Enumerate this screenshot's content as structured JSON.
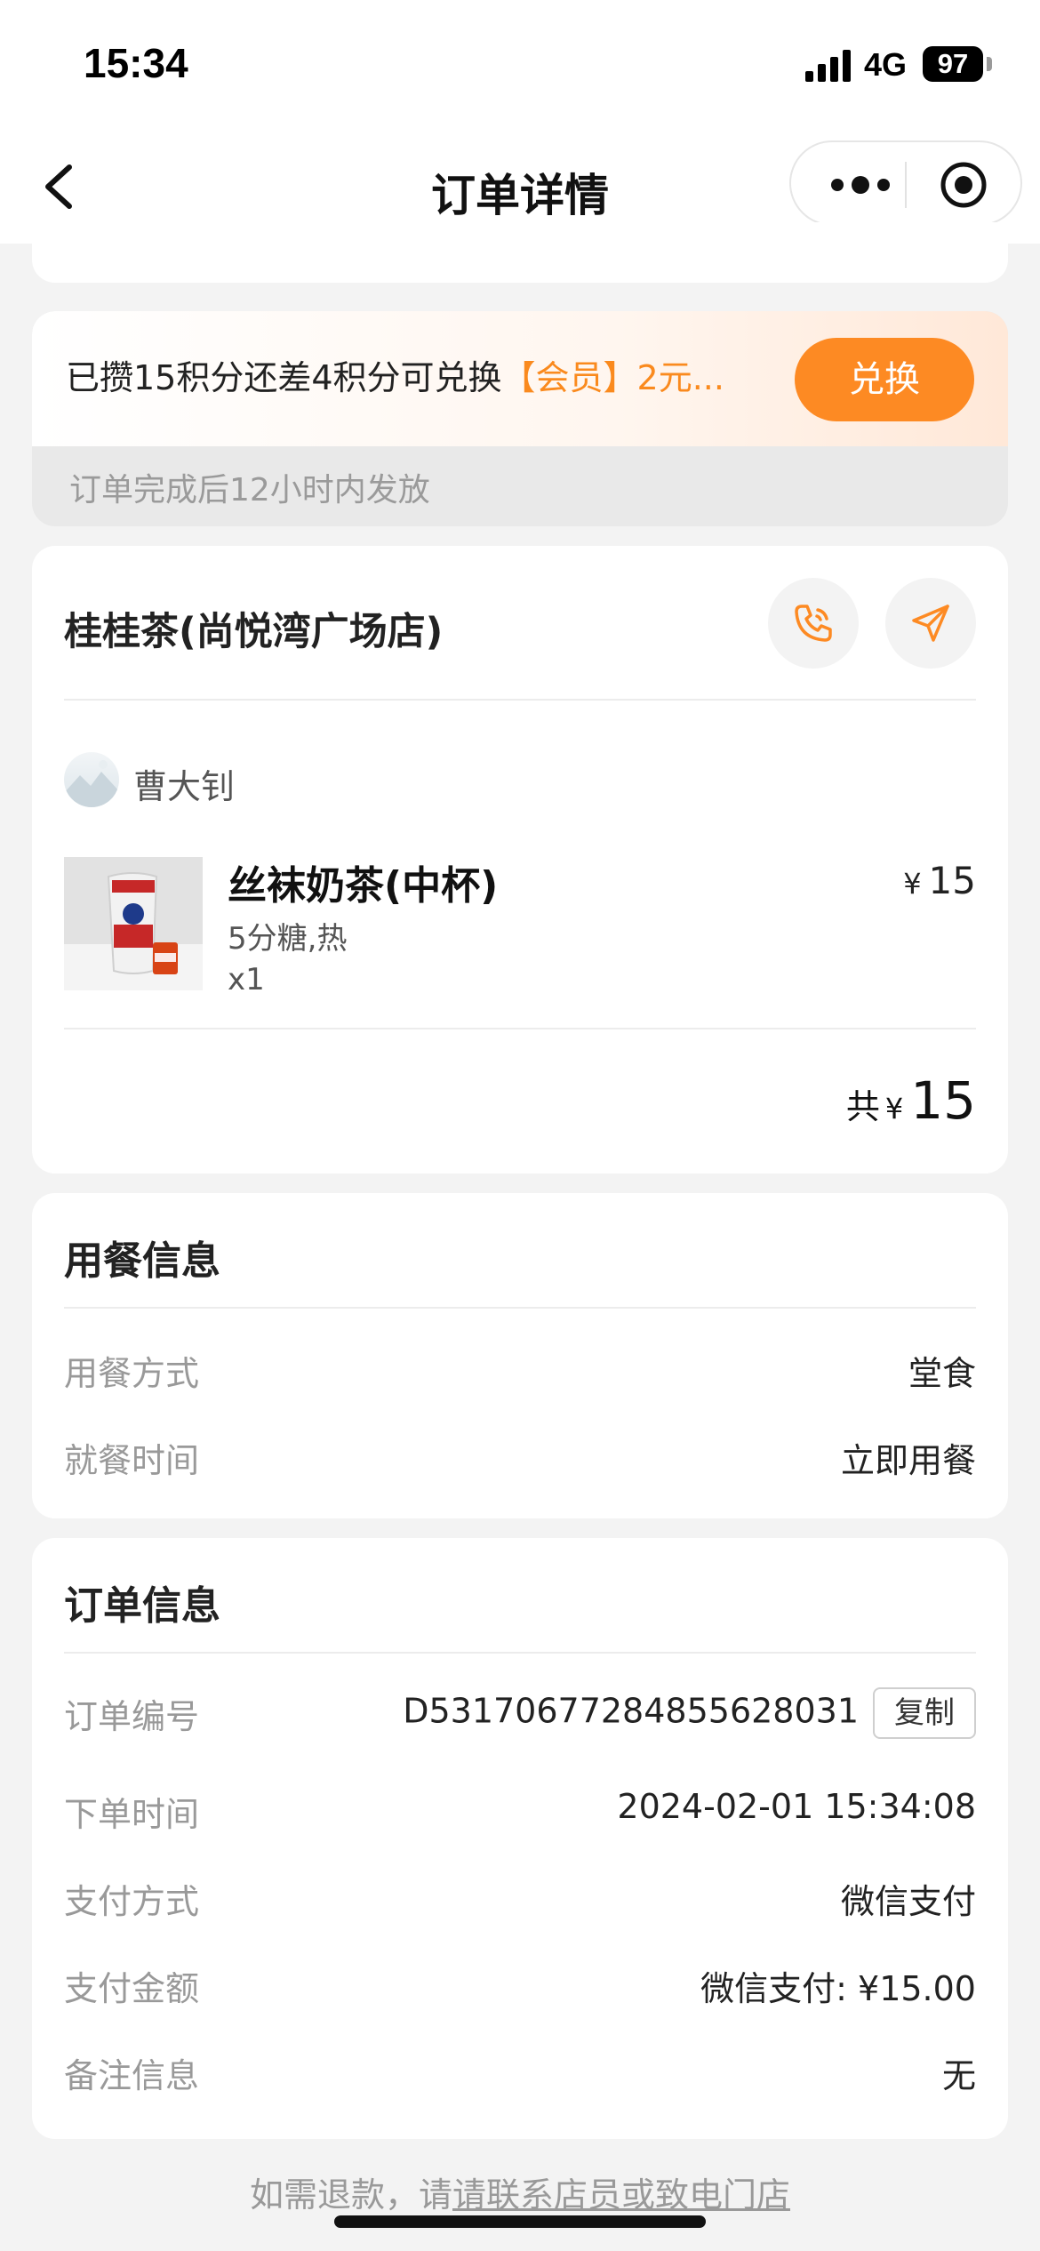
{
  "status_bar": {
    "time": "15:34",
    "network": "4G",
    "battery": "97"
  },
  "nav": {
    "title": "订单详情"
  },
  "points": {
    "text_prefix": "已攒15积分还差4积分可兑换",
    "text_highlight": "【会员】2元...",
    "redeem_label": "兑换",
    "note": "订单完成后12小时内发放"
  },
  "store": {
    "name": "桂桂茶(尚悦湾广场店)",
    "username": "曹大钊",
    "product": {
      "name": "丝袜奶茶(中杯)",
      "spec": "5分糖,热",
      "qty": "x1",
      "currency": "¥",
      "price": "15"
    },
    "total": {
      "label": "共",
      "currency": "¥",
      "amount": "15"
    }
  },
  "meal_info": {
    "title": "用餐信息",
    "rows": [
      {
        "label": "用餐方式",
        "value": "堂食"
      },
      {
        "label": "就餐时间",
        "value": "立即用餐"
      }
    ]
  },
  "order_info": {
    "title": "订单信息",
    "order_no_label": "订单编号",
    "order_no": "D53170677284855628031",
    "copy_label": "复制",
    "rows": [
      {
        "label": "下单时间",
        "value": "2024-02-01 15:34:08"
      },
      {
        "label": "支付方式",
        "value": "微信支付"
      },
      {
        "label": "支付金额",
        "value": "微信支付: ¥15.00"
      },
      {
        "label": "备注信息",
        "value": "无"
      }
    ]
  },
  "footer": {
    "prefix": "如需退款，请",
    "link": "请联系店员或致电门店"
  },
  "colors": {
    "accent": "#fd8a23",
    "background": "#f3f3f3"
  }
}
